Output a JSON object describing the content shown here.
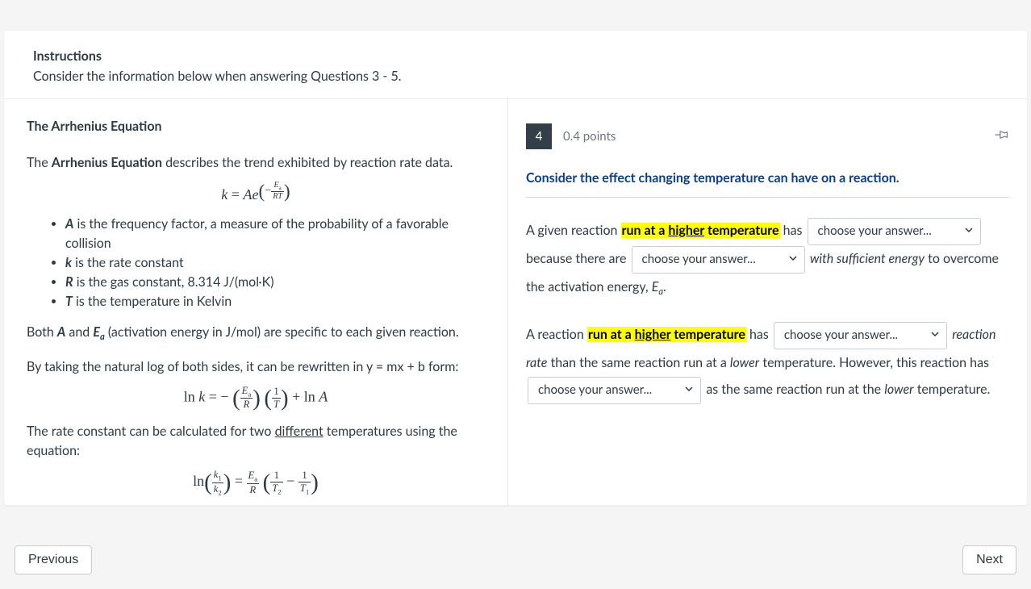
{
  "instructions": {
    "heading": "Instructions",
    "text": "Consider the information below when answering Questions 3 - 5."
  },
  "passage": {
    "title": "The Arrhenius Equation",
    "intro_pre": "The ",
    "intro_bold": "Arrhenius Equation",
    "intro_post": " describes the trend exhibited by reaction rate data.",
    "bullets": {
      "A": " is the frequency factor, a measure of the probability of a favorable collision",
      "k": " is the rate constant",
      "R": " is the gas constant, 8.314 J/(mol·K)",
      "T": " is the temperature in Kelvin"
    },
    "both_pre": "Both ",
    "both_A": "A",
    "both_and": " and ",
    "both_Ea_E": "E",
    "both_Ea_a": "a",
    "both_post": " (activation energy in J/mol) are specific to each given reaction.",
    "ln_intro": "By taking the natural log of both sides, it can be rewritten in y = mx + b form:",
    "two_temp_pre": "The rate constant can be calculated for two ",
    "two_temp_diff": "different",
    "two_temp_post": " temperatures using the equation:"
  },
  "question": {
    "number": "4",
    "points": "0.4 points",
    "prompt": "Consider the effect changing temperature can have on a reaction.",
    "t1_pre": "A given reaction ",
    "hl_pre": "run at a ",
    "hl_under": "higher",
    "hl_post": " temperature",
    "t1_post": " has ",
    "choose": "choose your answer...",
    "because": " because there are ",
    "italic_suff": "with sufficient energy",
    "t1_end_a": " to overcome the activation energy, ",
    "Ea_E": "E",
    "Ea_a": "a",
    "period": ".",
    "t2_pre": "A reaction ",
    "t2_mid": " has ",
    "italic_rate": "reaction rate",
    "t2_than": " than the same reaction run at a ",
    "italic_lower": "lower",
    "t2_temp": " temperature. However, this reaction has ",
    "t2_as": " as the same reaction run at the ",
    "t2_end": " temperature."
  },
  "nav": {
    "prev": "Previous",
    "next": "Next"
  }
}
